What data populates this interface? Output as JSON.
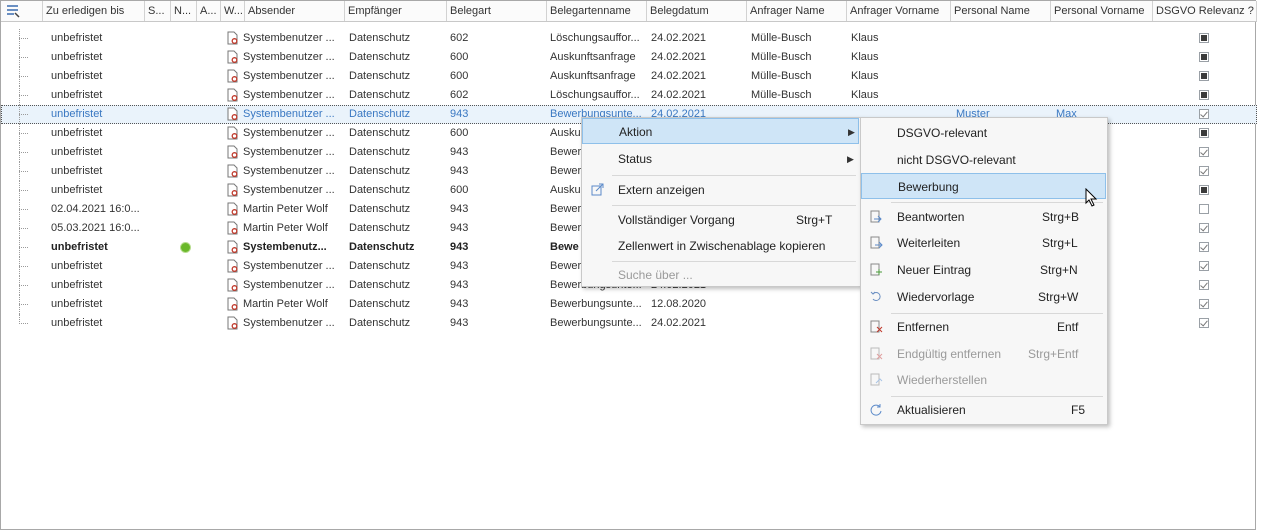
{
  "columns": {
    "zu_erledigen_bis": "Zu erledigen bis",
    "s": "S...",
    "n": "N...",
    "a": "A...",
    "w": "W...",
    "absender": "Absender",
    "empfaenger": "Empfänger",
    "belegart": "Belegart",
    "belegartenname": "Belegartenname",
    "belegdatum": "Belegdatum",
    "anfrager_name": "Anfrager Name",
    "anfrager_vorname": "Anfrager Vorname",
    "personal_name": "Personal Name",
    "personal_vorname": "Personal Vorname",
    "dsgvo": "DSGVO Relevanz ?"
  },
  "rows": [
    {
      "due": "unbefristet",
      "sender": "Systembenutzer ...",
      "recipient": "Datenschutz",
      "type": "602",
      "typename": "Löschungsauffor...",
      "date": "24.02.2021",
      "req_name": "Mülle-Busch",
      "req_first": "Klaus",
      "pers_name": "",
      "pers_first": "",
      "dsgvo": "fill"
    },
    {
      "due": "unbefristet",
      "sender": "Systembenutzer ...",
      "recipient": "Datenschutz",
      "type": "600",
      "typename": "Auskunftsanfrage",
      "date": "24.02.2021",
      "req_name": "Mülle-Busch",
      "req_first": "Klaus",
      "pers_name": "",
      "pers_first": "",
      "dsgvo": "fill"
    },
    {
      "due": "unbefristet",
      "sender": "Systembenutzer ...",
      "recipient": "Datenschutz",
      "type": "600",
      "typename": "Auskunftsanfrage",
      "date": "24.02.2021",
      "req_name": "Mülle-Busch",
      "req_first": "Klaus",
      "pers_name": "",
      "pers_first": "",
      "dsgvo": "fill"
    },
    {
      "due": "unbefristet",
      "sender": "Systembenutzer ...",
      "recipient": "Datenschutz",
      "type": "602",
      "typename": "Löschungsauffor...",
      "date": "24.02.2021",
      "req_name": "Mülle-Busch",
      "req_first": "Klaus",
      "pers_name": "",
      "pers_first": "",
      "dsgvo": "fill"
    },
    {
      "due": "unbefristet",
      "sender": "Systembenutzer ...",
      "recipient": "Datenschutz",
      "type": "943",
      "typename": "Bewerbungsunte...",
      "date": "24.02.2021",
      "req_name": "",
      "req_first": "",
      "pers_name": "Muster",
      "pers_first": "Max",
      "dsgvo": "tick"
    },
    {
      "due": "unbefristet",
      "sender": "Systembenutzer ...",
      "recipient": "Datenschutz",
      "type": "600",
      "typename": "Auskun",
      "date": "",
      "req_name": "",
      "req_first": "",
      "pers_name": "",
      "pers_first": "",
      "dsgvo": "fill"
    },
    {
      "due": "unbefristet",
      "sender": "Systembenutzer ...",
      "recipient": "Datenschutz",
      "type": "943",
      "typename": "Bewer",
      "date": "",
      "req_name": "",
      "req_first": "",
      "pers_name": "",
      "pers_first": "",
      "dsgvo": "tick"
    },
    {
      "due": "unbefristet",
      "sender": "Systembenutzer ...",
      "recipient": "Datenschutz",
      "type": "943",
      "typename": "Bewer",
      "date": "",
      "req_name": "",
      "req_first": "",
      "pers_name": "",
      "pers_first": "",
      "dsgvo": "tick"
    },
    {
      "due": "unbefristet",
      "sender": "Systembenutzer ...",
      "recipient": "Datenschutz",
      "type": "600",
      "typename": "Auskun",
      "date": "",
      "req_name": "",
      "req_first": "",
      "pers_name": "",
      "pers_first": "",
      "dsgvo": "fill"
    },
    {
      "due": "02.04.2021 16:0...",
      "sender": "Martin Peter Wolf",
      "recipient": "Datenschutz",
      "type": "943",
      "typename": "Bewer",
      "date": "",
      "req_name": "",
      "req_first": "",
      "pers_name": "",
      "pers_first": "",
      "dsgvo": "empty"
    },
    {
      "due": "05.03.2021 16:0...",
      "sender": "Martin Peter Wolf",
      "recipient": "Datenschutz",
      "type": "943",
      "typename": "Bewer",
      "date": "",
      "req_name": "",
      "req_first": "",
      "pers_name": "",
      "pers_first": "",
      "dsgvo": "tick"
    },
    {
      "due": "unbefristet",
      "sender": "Systembenutz...",
      "recipient": "Datenschutz",
      "type": "943",
      "typename": "Bewe",
      "date": "",
      "req_name": "",
      "req_first": "",
      "pers_name": "",
      "pers_first": "",
      "dsgvo": "tick"
    },
    {
      "due": "unbefristet",
      "sender": "Systembenutzer ...",
      "recipient": "Datenschutz",
      "type": "943",
      "typename": "Bewer",
      "date": "",
      "req_name": "",
      "req_first": "",
      "pers_name": "",
      "pers_first": "",
      "dsgvo": "tick"
    },
    {
      "due": "unbefristet",
      "sender": "Systembenutzer ...",
      "recipient": "Datenschutz",
      "type": "943",
      "typename": "Bewerbungsunte...",
      "date": "24.02.2021",
      "req_name": "",
      "req_first": "",
      "pers_name": "",
      "pers_first": "",
      "dsgvo": "tick"
    },
    {
      "due": "unbefristet",
      "sender": "Martin Peter Wolf",
      "recipient": "Datenschutz",
      "type": "943",
      "typename": "Bewerbungsunte...",
      "date": "12.08.2020",
      "req_name": "",
      "req_first": "",
      "pers_name": "",
      "pers_first": "",
      "dsgvo": "tick"
    },
    {
      "due": "unbefristet",
      "sender": "Systembenutzer ...",
      "recipient": "Datenschutz",
      "type": "943",
      "typename": "Bewerbungsunte...",
      "date": "24.02.2021",
      "req_name": "",
      "req_first": "",
      "pers_name": "",
      "pers_first": "",
      "dsgvo": "tick"
    }
  ],
  "context_menu": {
    "aktion": "Aktion",
    "status": "Status",
    "extern": "Extern anzeigen",
    "vollstaendig": "Vollständiger Vorgang",
    "vollstaendig_sc": "Strg+T",
    "zellenwert": "Zellenwert in Zwischenablage kopieren",
    "suche": "Suche über ..."
  },
  "submenu": {
    "dsgvo_relevant": "DSGVO-relevant",
    "nicht_dsgvo": "nicht DSGVO-relevant",
    "bewerbung": "Bewerbung",
    "beantworten": "Beantworten",
    "beantworten_sc": "Strg+B",
    "weiterleiten": "Weiterleiten",
    "weiterleiten_sc": "Strg+L",
    "neuer_eintrag": "Neuer Eintrag",
    "neuer_eintrag_sc": "Strg+N",
    "wiedervorlage": "Wiedervorlage",
    "wiedervorlage_sc": "Strg+W",
    "entfernen": "Entfernen",
    "entfernen_sc": "Entf",
    "endgueltig": "Endgültig entfernen",
    "endgueltig_sc": "Strg+Entf",
    "wiederherstellen": "Wiederherstellen",
    "aktualisieren": "Aktualisieren",
    "aktualisieren_sc": "F5"
  },
  "colors": {
    "selection_text": "#3a78c2",
    "highlight": "#cfe5f7",
    "status_dot": "#6ab82a"
  },
  "icons": [
    "column-chooser-icon",
    "document-seal-icon",
    "status-dot-icon",
    "chevron-right-icon",
    "external-view-icon",
    "reply-icon",
    "forward-icon",
    "new-entry-icon",
    "resubmission-icon",
    "remove-icon",
    "delete-permanent-icon",
    "restore-icon",
    "refresh-icon",
    "mouse-cursor-icon"
  ]
}
